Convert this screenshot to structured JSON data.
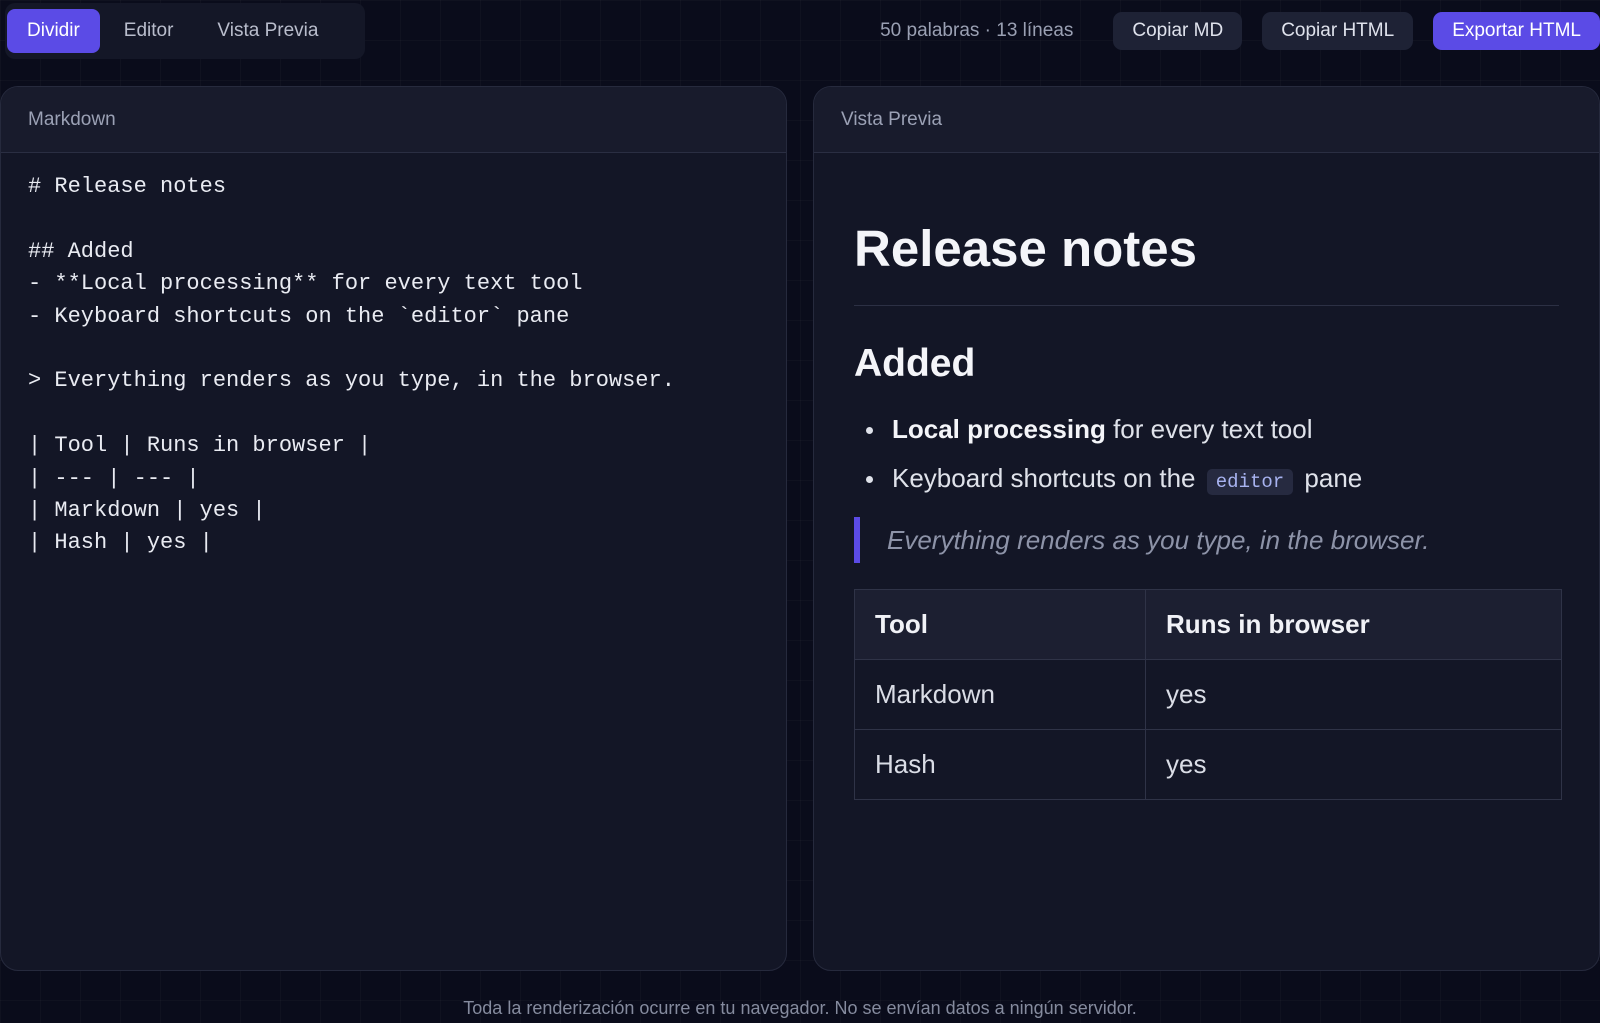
{
  "modes": [
    "Dividir",
    "Editor",
    "Vista Previa"
  ],
  "active_mode": "Dividir",
  "stats": "50 palabras · 13 líneas",
  "actions": {
    "copy_md": "Copiar MD",
    "copy_html": "Copiar HTML",
    "export_html": "Exportar HTML"
  },
  "editor": {
    "title": "Markdown",
    "content": "# Release notes\n\n## Added\n- **Local processing** for every text tool\n- Keyboard shortcuts on the `editor` pane\n\n> Everything renders as you type, in the browser.\n\n| Tool | Runs in browser |\n| --- | --- |\n| Markdown | yes |\n| Hash | yes |"
  },
  "preview": {
    "title": "Vista Previa",
    "h1": "Release notes",
    "h2": "Added",
    "list": [
      {
        "bold": "Local processing",
        "text": " for every text tool"
      },
      {
        "before": "Keyboard shortcuts on the",
        "code": "editor",
        "after": "pane"
      }
    ],
    "quote": "Everything renders as you type, in the browser.",
    "table": {
      "headers": [
        "Tool",
        "Runs in browser"
      ],
      "rows": [
        [
          "Markdown",
          "yes"
        ],
        [
          "Hash",
          "yes"
        ]
      ]
    }
  },
  "footer": "Toda la renderización ocurre en tu navegador. No se envían datos a ningún servidor.",
  "colors": {
    "accent": "#5b4be6",
    "background": "#0a0c1b",
    "panel": "#131626"
  }
}
